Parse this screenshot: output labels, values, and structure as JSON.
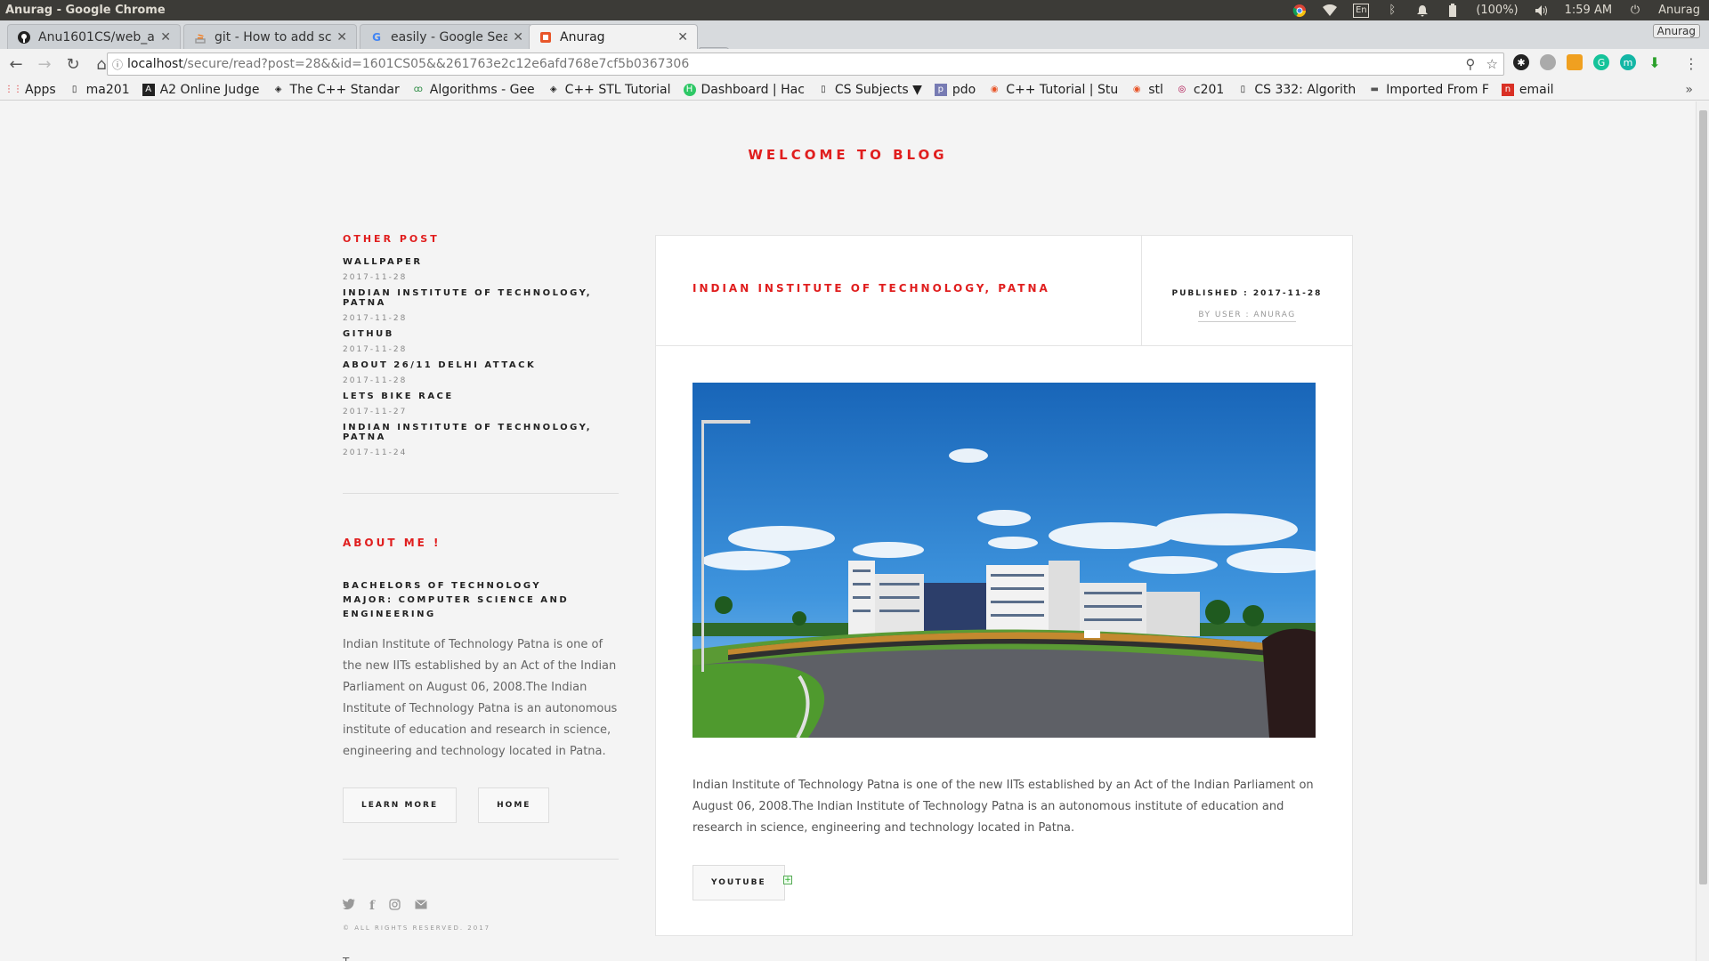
{
  "os_bar": {
    "title": "Anurag - Google Chrome",
    "battery": "(100%)",
    "time": "1:59 AM",
    "user": "Anurag",
    "keyboard": "En"
  },
  "tabs": [
    {
      "label": "Anu1601CS/web_ap",
      "icon": "github-icon"
    },
    {
      "label": "git - How to add scr",
      "icon": "stackoverflow-icon"
    },
    {
      "label": "easily - Google Sear",
      "icon": "google-icon"
    },
    {
      "label": "Anurag",
      "icon": "page-icon"
    }
  ],
  "profile_chip": "Anurag",
  "address": {
    "host": "localhost",
    "path": "/secure/read?post=28&&id=1601CS05&&261763e2c12e6afd768e7cf5b0367306"
  },
  "bookmarks": [
    "Apps",
    "ma201",
    "A2 Online Judge",
    "The C++ Standar",
    "Algorithms - Gee",
    "C++ STL Tutorial",
    "Dashboard | Hac",
    "CS Subjects ▼",
    "pdo",
    "C++ Tutorial | Stu",
    "stl",
    "c201",
    "CS 332: Algorith",
    "Imported From F",
    "email"
  ],
  "bookmarks_more": "»",
  "page": {
    "welcome": "WELCOME TO BLOG",
    "sidebar": {
      "other_post_heading": "OTHER POST",
      "posts": [
        {
          "title": "WALLPAPER",
          "date": "2017-11-28"
        },
        {
          "title": "INDIAN INSTITUTE OF TECHNOLOGY, PATNA",
          "date": "2017-11-28"
        },
        {
          "title": "GITHUB",
          "date": "2017-11-28"
        },
        {
          "title": "ABOUT 26/11 DELHI ATTACK",
          "date": "2017-11-28"
        },
        {
          "title": "LETS BIKE RACE",
          "date": "2017-11-27"
        },
        {
          "title": "INDIAN INSTITUTE OF TECHNOLOGY, PATNA",
          "date": "2017-11-24"
        }
      ],
      "about_heading": "ABOUT ME !",
      "degree_line1": "BACHELORS OF TECHNOLOGY",
      "degree_line2": "MAJOR: COMPUTER SCIENCE AND ENGINEERING",
      "about_text": "Indian Institute of Technology Patna is one of the new IITs established by an Act of the Indian Parliament on August 06, 2008.The Indian Institute of Technology Patna is an autonomous institute of education and research in science, engineering and technology located in Patna.",
      "learn_more": "LEARN MORE",
      "home": "HOME",
      "copyright": "© ALL RIGHTS RESERVED. 2017",
      "footer_cut": "T"
    },
    "post": {
      "title": "INDIAN INSTITUTE OF TECHNOLOGY, PATNA",
      "published": "PUBLISHED : 2017-11-28",
      "by_user": "BY USER : ANURAG",
      "body": "Indian Institute of Technology Patna is one of the new IITs established by an Act of the Indian Parliament on August 06, 2008.The Indian Institute of Technology Patna is an autonomous institute of education and research in science, engineering and technology located in Patna.",
      "youtube": "YOUTUBE"
    }
  },
  "colors": {
    "accent": "#e01e1e",
    "sky": "#1f78c8",
    "grass": "#4f9a2e"
  }
}
